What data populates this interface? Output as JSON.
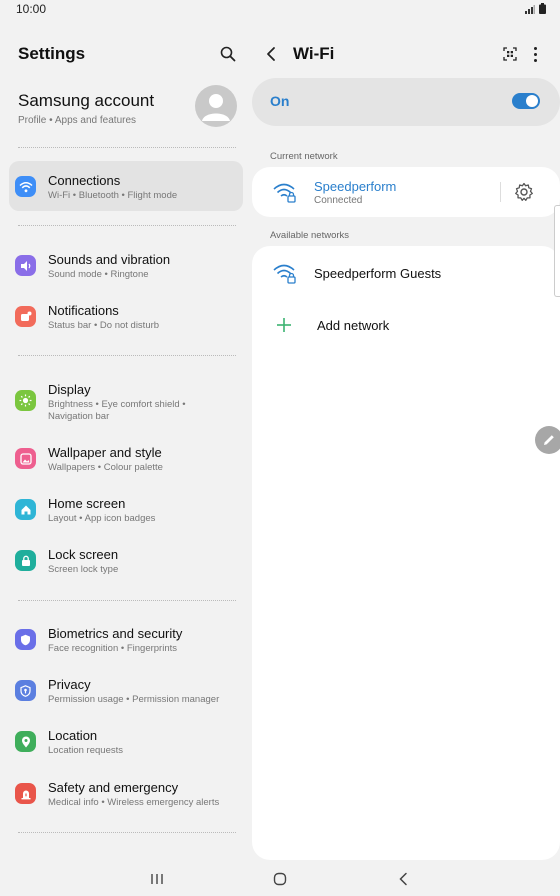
{
  "status_bar": {
    "time": "10:00"
  },
  "left_pane": {
    "title": "Settings",
    "account": {
      "title": "Samsung account",
      "subtitle": "Profile  •  Apps and features"
    },
    "items": [
      {
        "id": "connections",
        "title": "Connections",
        "subtitle": "Wi-Fi  •  Bluetooth  •  Flight mode",
        "icon": "wifi-icon",
        "color": "#3e8ef7",
        "selected": true
      },
      {
        "id": "sounds",
        "title": "Sounds and vibration",
        "subtitle": "Sound mode  •  Ringtone",
        "icon": "speaker-icon",
        "color": "#8a6ee8"
      },
      {
        "id": "notifications",
        "title": "Notifications",
        "subtitle": "Status bar  •  Do not disturb",
        "icon": "notification-icon",
        "color": "#f26b5b"
      },
      {
        "id": "display",
        "title": "Display",
        "subtitle": "Brightness  •  Eye comfort shield  •",
        "subtitle2": "Navigation bar",
        "icon": "sun-icon",
        "color": "#7bc63f"
      },
      {
        "id": "wallpaper",
        "title": "Wallpaper and style",
        "subtitle": "Wallpapers  •  Colour palette",
        "icon": "image-icon",
        "color": "#ee5f8f"
      },
      {
        "id": "home",
        "title": "Home screen",
        "subtitle": "Layout  •  App icon badges",
        "icon": "home-icon",
        "color": "#2fb5d6"
      },
      {
        "id": "lock",
        "title": "Lock screen",
        "subtitle": "Screen lock type",
        "icon": "lock-icon",
        "color": "#1fae9c"
      },
      {
        "id": "biometrics",
        "title": "Biometrics and security",
        "subtitle": "Face recognition  •  Fingerprints",
        "icon": "shield-icon",
        "color": "#6a6fe8"
      },
      {
        "id": "privacy",
        "title": "Privacy",
        "subtitle": "Permission usage  •  Permission manager",
        "icon": "privacy-icon",
        "color": "#5b7fe0"
      },
      {
        "id": "location",
        "title": "Location",
        "subtitle": "Location requests",
        "icon": "location-icon",
        "color": "#3fae5b"
      },
      {
        "id": "safety",
        "title": "Safety and emergency",
        "subtitle": "Medical info  •  Wireless emergency alerts",
        "icon": "emergency-icon",
        "color": "#e9554a"
      }
    ]
  },
  "right_pane": {
    "title": "Wi-Fi",
    "toggle": {
      "label": "On",
      "state": "on"
    },
    "current_network_label": "Current network",
    "current_network": {
      "name": "Speedperform",
      "status": "Connected"
    },
    "available_networks_label": "Available networks",
    "available_networks": [
      {
        "name": "Speedperform Guests"
      }
    ],
    "add_network_label": "Add network"
  },
  "colors": {
    "accent": "#2a7fcc",
    "background": "#f2f2f2"
  }
}
